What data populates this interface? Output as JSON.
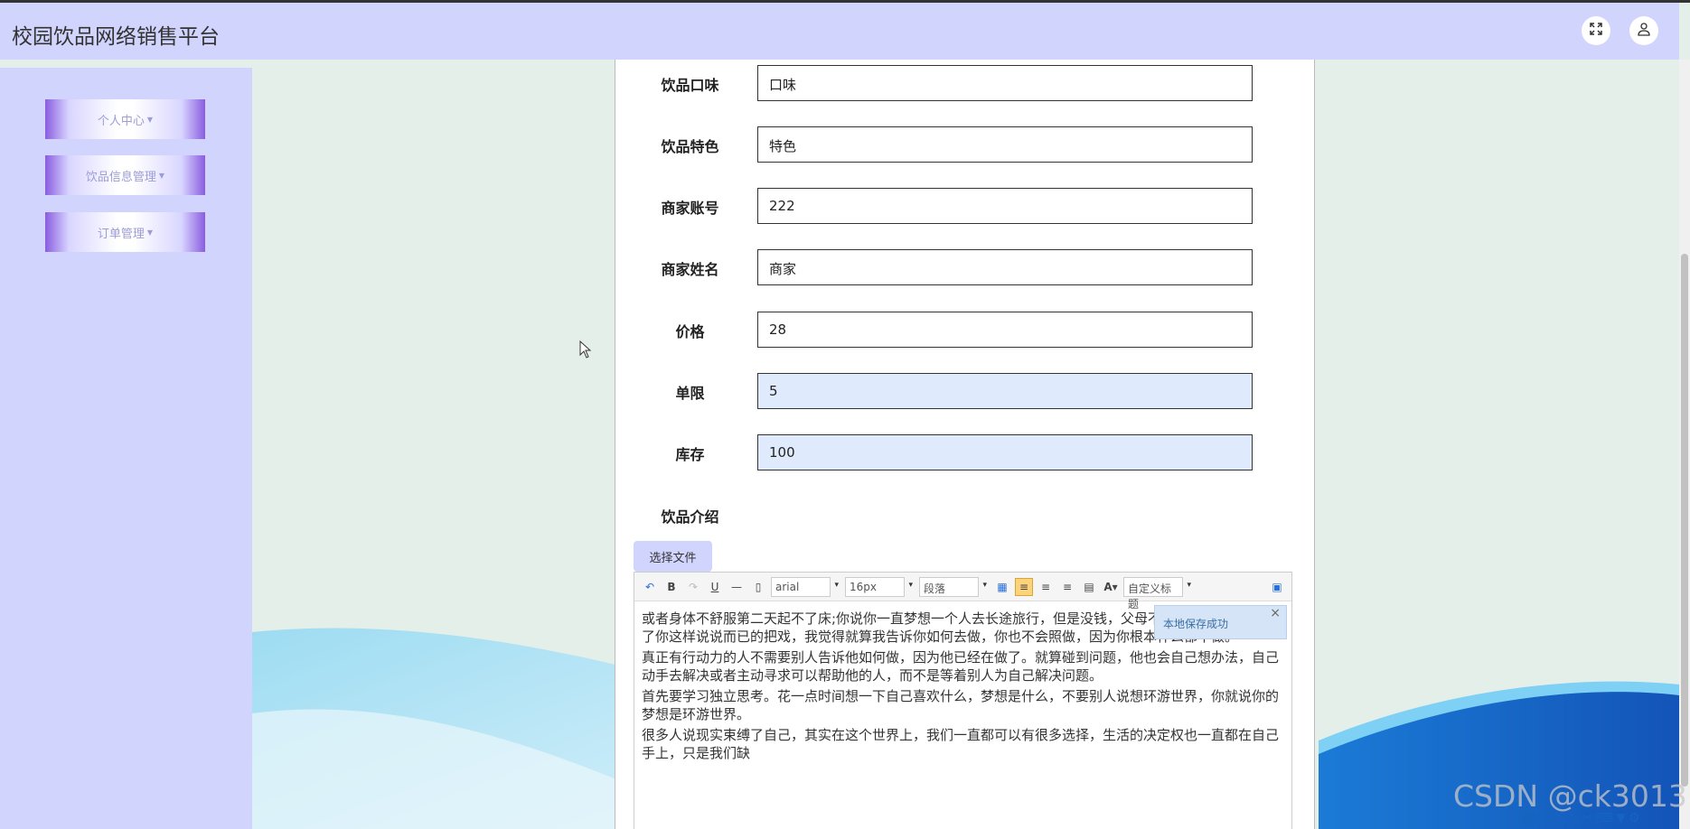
{
  "app": {
    "title": "校园饮品网络销售平台"
  },
  "header": {
    "fullscreen_icon": "expand-icon",
    "user_icon": "user-icon"
  },
  "sidebar": {
    "items": [
      {
        "label": "个人中心"
      },
      {
        "label": "饮品信息管理"
      },
      {
        "label": "订单管理"
      }
    ]
  },
  "form": {
    "fields": [
      {
        "label": "饮品口味",
        "value": "口味",
        "readonly": false
      },
      {
        "label": "饮品特色",
        "value": "特色",
        "readonly": false
      },
      {
        "label": "商家账号",
        "value": "222",
        "readonly": false
      },
      {
        "label": "商家姓名",
        "value": "商家",
        "readonly": false
      },
      {
        "label": "价格",
        "value": "28",
        "readonly": false
      },
      {
        "label": "单限",
        "value": "5",
        "readonly": true
      },
      {
        "label": "库存",
        "value": "100",
        "readonly": true
      }
    ],
    "intro_label": "饮品介绍",
    "file_button": "选择文件"
  },
  "editor": {
    "font_family": "arial",
    "font_size": "16px",
    "paragraph": "段落",
    "custom_title": "自定义标题",
    "toast": "本地保存成功",
    "paragraphs": [
      "或者身体不舒服第二天起不了床;你说你一直梦想一个人去长途旅行，但是没钱，父母不让。其实我已经厌倦了你这样说说而已的把戏，我觉得就算我告诉你如何去做，你也不会照做，因为你根本什么都不做。",
      "真正有行动力的人不需要别人告诉他如何做，因为他已经在做了。就算碰到问题，他也会自己想办法，自己动手去解决或者主动寻求可以帮助他的人，而不是等着别人为自己解决问题。",
      "首先要学习独立思考。花一点时间想一下自己喜欢什么，梦想是什么，不要别人说想环游世界，你就说你的梦想是环游世界。",
      "很多人说现实束缚了自己，其实在这个世界上，我们一直都可以有很多选择，生活的决定权也一直都在自己手上，只是我们缺"
    ]
  },
  "watermark": "CSDN @ck3013",
  "ime": {
    "label": "中"
  },
  "colors": {
    "header": "#d1d4fd",
    "sidebar": "#d1d4fd",
    "accent": "#8a5ce0",
    "readonly_field": "#dfeafc"
  }
}
